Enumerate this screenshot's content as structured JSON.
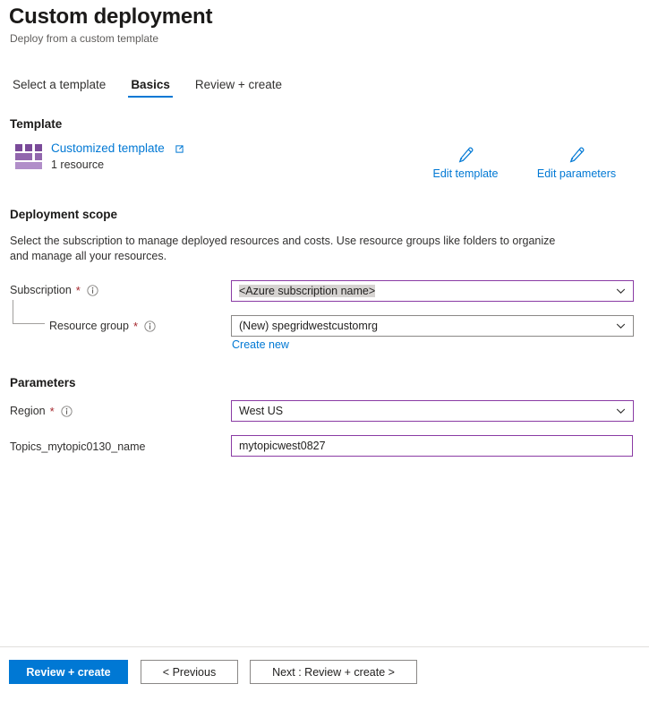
{
  "header": {
    "title": "Custom deployment",
    "subtitle": "Deploy from a custom template"
  },
  "tabs": [
    {
      "label": "Select a template",
      "active": false
    },
    {
      "label": "Basics",
      "active": true
    },
    {
      "label": "Review + create",
      "active": false
    }
  ],
  "template_section": {
    "heading": "Template",
    "icon": "template-blocks-icon",
    "link_label": "Customized template",
    "external_icon": "external-link-icon",
    "resource_count": "1 resource",
    "actions": [
      {
        "icon": "pencil-icon",
        "label": "Edit template"
      },
      {
        "icon": "pencil-icon",
        "label": "Edit parameters"
      }
    ]
  },
  "deployment_scope": {
    "heading": "Deployment scope",
    "description": "Select the subscription to manage deployed resources and costs. Use resource groups like folders to organize and manage all your resources.",
    "subscription": {
      "label": "Subscription",
      "required": "*",
      "info_icon": "info-icon",
      "value": "<Azure subscription name>",
      "chevron": "chevron-down-icon"
    },
    "resource_group": {
      "label": "Resource group",
      "required": "*",
      "info_icon": "info-icon",
      "value": "(New) spegridwestcustomrg",
      "chevron": "chevron-down-icon",
      "create_new_label": "Create new"
    }
  },
  "parameters": {
    "heading": "Parameters",
    "region": {
      "label": "Region",
      "required": "*",
      "info_icon": "info-icon",
      "value": "West US",
      "chevron": "chevron-down-icon"
    },
    "topic_name": {
      "label": "Topics_mytopic0130_name",
      "value": "mytopicwest0827",
      "placeholder": ""
    }
  },
  "footer": {
    "review_create": "Review + create",
    "previous": "< Previous",
    "next": "Next : Review + create >"
  },
  "colors": {
    "accent_blue": "#0078d4",
    "field_accent": "#8a3ba4",
    "required_red": "#a4262c",
    "icon_purple": "#7a4a99"
  }
}
